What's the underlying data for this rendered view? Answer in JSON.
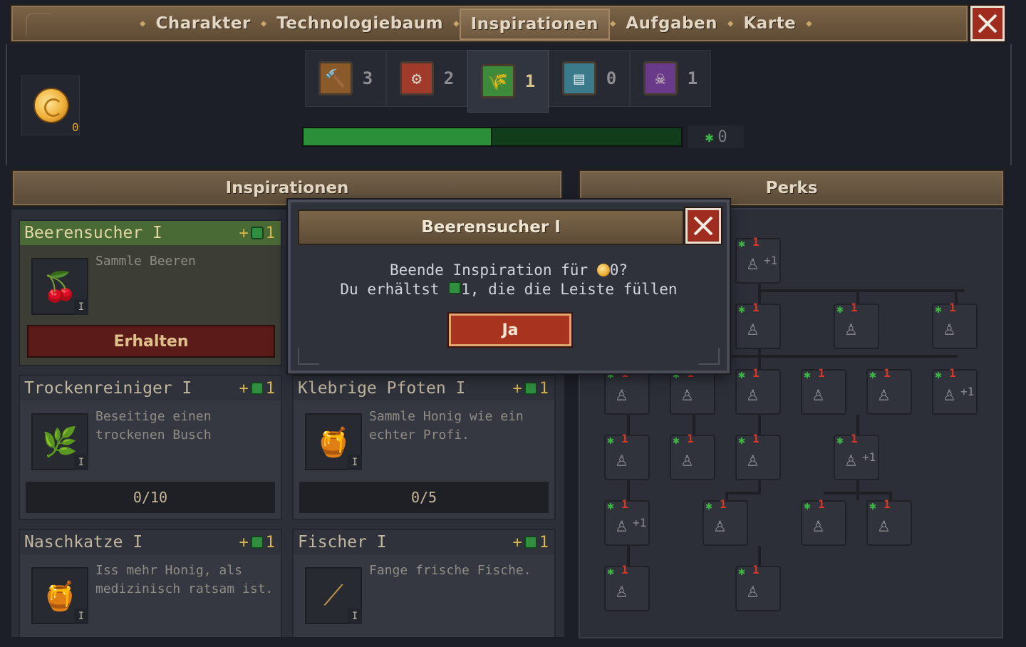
{
  "tabs": [
    {
      "label": "Charakter"
    },
    {
      "label": "Technologiebaum"
    },
    {
      "label": "Inspirationen",
      "active": true
    },
    {
      "label": "Aufgaben"
    },
    {
      "label": "Karte"
    }
  ],
  "currency": {
    "icon": "gold-coin-icon",
    "count": "0"
  },
  "categories": [
    {
      "icon": "hammer-icon",
      "count": "3",
      "color": "#8b5a2b"
    },
    {
      "icon": "gear-icon",
      "count": "2",
      "color": "#a03a2a"
    },
    {
      "icon": "wheat-icon",
      "count": "1",
      "color": "#3d8a3a",
      "active": true
    },
    {
      "icon": "book-icon",
      "count": "0",
      "color": "#3a7a8a"
    },
    {
      "icon": "skull-icon",
      "count": "1",
      "color": "#6a3a8a"
    }
  ],
  "progress": {
    "fraction": 0.5,
    "count": "0"
  },
  "sections": {
    "inspirations": "Inspirationen",
    "perks": "Perks"
  },
  "cards": [
    {
      "title": "Beerensucher I",
      "reward": "1",
      "desc": "Sammle Beeren",
      "tier": "I",
      "icon": "berries-icon",
      "action": "Erhalten"
    },
    {
      "title": "Trockenreiniger I",
      "reward": "1",
      "desc": "Beseitige einen trockenen Busch",
      "tier": "I",
      "icon": "bush-icon",
      "progress": "0/10"
    },
    {
      "title": "Klebrige Pfoten I",
      "reward": "1",
      "desc": "Sammle Honig wie ein echter Profi.",
      "tier": "I",
      "icon": "honey-icon",
      "progress": "0/5"
    },
    {
      "title": "Naschkatze I",
      "reward": "1",
      "desc": "Iss mehr Honig, als medizinisch ratsam ist.",
      "tier": "I",
      "icon": "honey-pot-icon"
    },
    {
      "title": "Fischer I",
      "reward": "1",
      "desc": "Fange frische Fische.",
      "tier": "I",
      "icon": "fishing-rod-icon"
    }
  ],
  "perks": {
    "cost": "1",
    "bonus_label": "+1"
  },
  "modal": {
    "title": "Beerensucher I",
    "line1_a": "Beende Inspiration für",
    "line1_b": "0?",
    "line2_a": "Du erhältst",
    "line2_b": "1, die die Leiste füllen",
    "confirm": "Ja"
  }
}
